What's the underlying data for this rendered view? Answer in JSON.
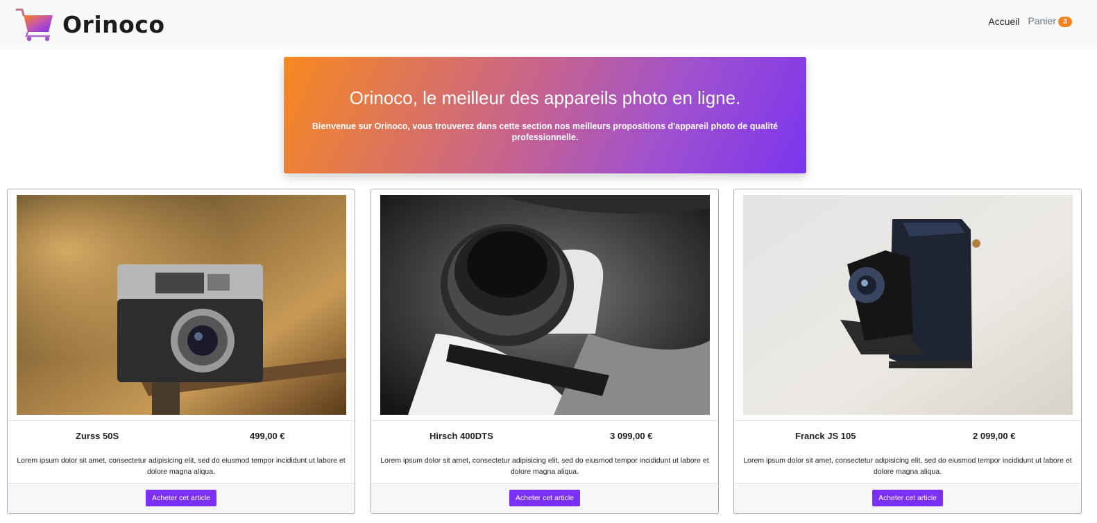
{
  "brand": {
    "name": "Orinoco",
    "accent": "#7b2ff7",
    "orange": "#f5821f"
  },
  "nav": {
    "accueil": "Accueil",
    "panier": "Panier",
    "cart_count": "3"
  },
  "hero": {
    "title": "Orinoco, le meilleur des appareils photo en ligne.",
    "subtitle": "Bienvenue sur Orinoco, vous trouverez dans cette section nos meilleurs propositions d'appareil photo de qualité professionnelle."
  },
  "products": [
    {
      "name": "Zurss 50S",
      "price": "499,00 €",
      "description": "Lorem ipsum dolor sit amet, consectetur adipisicing elit, sed do eiusmod tempor incididunt ut labore et dolore magna aliqua.",
      "button": "Acheter cet article"
    },
    {
      "name": "Hirsch 400DTS",
      "price": "3 099,00 €",
      "description": "Lorem ipsum dolor sit amet, consectetur adipisicing elit, sed do eiusmod tempor incididunt ut labore et dolore magna aliqua.",
      "button": "Acheter cet article"
    },
    {
      "name": "Franck JS 105",
      "price": "2 099,00 €",
      "description": "Lorem ipsum dolor sit amet, consectetur adipisicing elit, sed do eiusmod tempor incididunt ut labore et dolore magna aliqua.",
      "button": "Acheter cet article"
    }
  ]
}
